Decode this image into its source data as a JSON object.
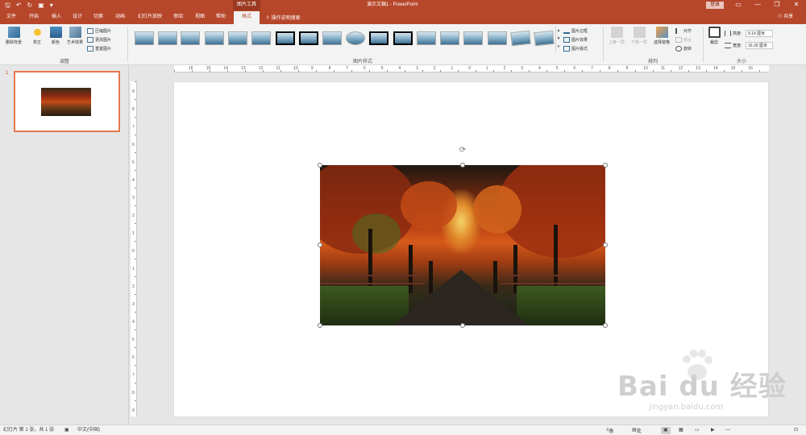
{
  "titlebar": {
    "context_tab": "图片工具",
    "document_title": "演示文稿1  -  PowerPoint",
    "login": "登录",
    "controls": {
      "ribbon_display": "▭",
      "minimize": "—",
      "restore": "❐",
      "close": "✕"
    },
    "accent_color": "#b7472a"
  },
  "tabs": [
    {
      "label": "文件",
      "active": false
    },
    {
      "label": "开始",
      "active": false
    },
    {
      "label": "插入",
      "active": false
    },
    {
      "label": "设计",
      "active": false
    },
    {
      "label": "切换",
      "active": false
    },
    {
      "label": "动画",
      "active": false
    },
    {
      "label": "幻灯片放映",
      "active": false
    },
    {
      "label": "审阅",
      "active": false
    },
    {
      "label": "视图",
      "active": false
    },
    {
      "label": "帮助",
      "active": false
    },
    {
      "label": "格式",
      "active": true
    }
  ],
  "tell_me": "操作说明搜索",
  "share": "共享",
  "ribbon": {
    "adjust": {
      "remove_background": "删除背景",
      "corrections": "校正",
      "color": "颜色",
      "artistic_effects": "艺术效果",
      "compress": "压缩图片",
      "change_picture": "更改图片",
      "reset_picture": "重置图片",
      "group_label": "调整"
    },
    "styles": {
      "group_label": "图片样式",
      "border": "图片边框",
      "effects": "图片效果",
      "layout": "图片版式"
    },
    "arrange": {
      "bring_forward": "上移一层",
      "send_backward": "下移一层",
      "selection_pane": "选择窗格",
      "align": "对齐",
      "group": "组合",
      "rotate": "旋转",
      "group_label": "排列"
    },
    "size": {
      "crop": "裁剪",
      "height_label": "高度:",
      "height_value": "9.14 厘米",
      "width_label": "宽度:",
      "width_value": "16.26 厘米",
      "group_label": "大小"
    }
  },
  "slide_pane": {
    "slide_number": "1"
  },
  "ruler": {
    "horizontal": [
      "16",
      "15",
      "14",
      "13",
      "12",
      "11",
      "10",
      "9",
      "8",
      "7",
      "6",
      "5",
      "4",
      "3",
      "2",
      "1",
      "0",
      "1",
      "2",
      "3",
      "4",
      "5",
      "6",
      "7",
      "8",
      "9",
      "10",
      "11",
      "12",
      "13",
      "14",
      "15",
      "16"
    ],
    "vertical": [
      "9",
      "8",
      "7",
      "6",
      "5",
      "4",
      "3",
      "2",
      "1",
      "0",
      "1",
      "2",
      "3",
      "4",
      "5",
      "6",
      "7",
      "8",
      "9"
    ]
  },
  "statusbar": {
    "slide_info": "幻灯片 第 1 张，共 1 张",
    "language": "中文(中国)",
    "notes": "备注",
    "comments": "批注"
  },
  "watermark": {
    "brand": "Bai du 经验",
    "url": "jingyan.baidu.com"
  }
}
